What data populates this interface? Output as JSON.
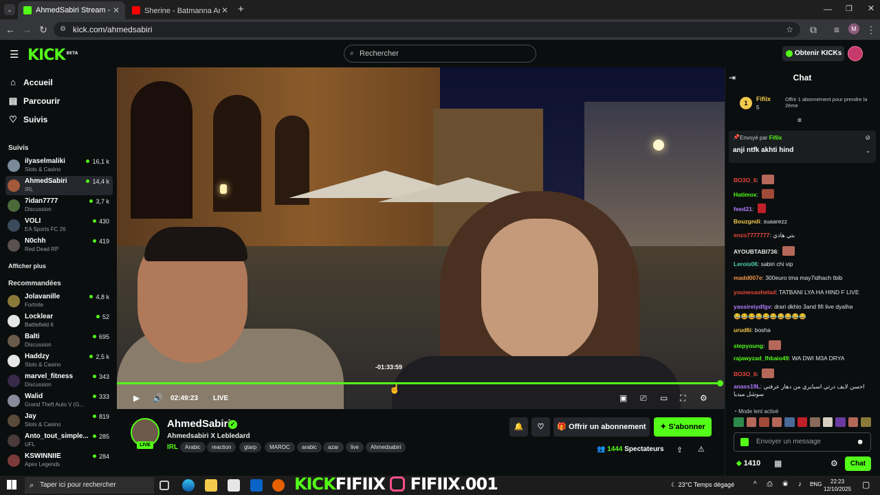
{
  "browser": {
    "tabs": [
      {
        "title": "AhmedSabiri Stream - Watch Live",
        "active": true
      },
      {
        "title": "Sherine - Batmanna Ansak | لان",
        "active": false
      }
    ],
    "url": "kick.com/ahmedsabiri",
    "profile_initial": "M"
  },
  "header": {
    "logo": "KICK",
    "logo_sup": "BETA",
    "search_placeholder": "Rechercher",
    "get_kicks": "Obtenir KICKs"
  },
  "sidebar": {
    "nav": [
      {
        "label": "Accueil",
        "icon": "home-icon"
      },
      {
        "label": "Parcourir",
        "icon": "browse-icon"
      },
      {
        "label": "Suivis",
        "icon": "heart-icon"
      }
    ],
    "followed_title": "Suivis",
    "followed": [
      {
        "name": "ilyaselmaliki",
        "category": "Slots & Casino",
        "viewers": "16,1 k",
        "color": "#7a8a99"
      },
      {
        "name": "AhmedSabiri",
        "category": "IRL",
        "viewers": "14,4 k",
        "color": "#a35a3a"
      },
      {
        "name": "7idan7777",
        "category": "Discussion",
        "viewers": "3,7 k",
        "color": "#4a6a3a"
      },
      {
        "name": "VOLI",
        "category": "EA Sports FC 26",
        "viewers": "430",
        "color": "#3a4a5a"
      },
      {
        "name": "N0chh",
        "category": "Red Dead RP",
        "viewers": "419",
        "color": "#5a5050"
      }
    ],
    "show_more": "Afficher plus",
    "recommended_title": "Recommandées",
    "recommended": [
      {
        "name": "Jolavanille",
        "category": "Fortnite",
        "viewers": "4,8 k",
        "color": "#8a7a3a"
      },
      {
        "name": "Locklear",
        "category": "Battlefield 6",
        "viewers": "52",
        "color": "#ffffff"
      },
      {
        "name": "Balti",
        "category": "Discussion",
        "viewers": "695",
        "color": "#6a5a4a"
      },
      {
        "name": "Haddzy",
        "category": "Slots & Casino",
        "viewers": "2,5 k",
        "color": "#e6e6e6"
      },
      {
        "name": "marvel_fitness",
        "category": "Discussion",
        "viewers": "343",
        "color": "#3a2a4a"
      },
      {
        "name": "Walid",
        "category": "Grand Theft Auto V (G...",
        "viewers": "333",
        "color": "#8a8a9a"
      },
      {
        "name": "Jay",
        "category": "Slots & Casino",
        "viewers": "819",
        "color": "#5a4a3a"
      },
      {
        "name": "Anto_tout_simple...",
        "category": "UFL",
        "viewers": "285",
        "color": "#4a3a3a"
      },
      {
        "name": "KSWINNIIE",
        "category": "Apex Legends",
        "viewers": "284",
        "color": "#7a3a3a"
      }
    ]
  },
  "player": {
    "hover_time": "-01:33:59",
    "elapsed": "02:49:23",
    "live_label": "LIVE",
    "progress": 1.0
  },
  "stream": {
    "name": "AhmedSabiri",
    "title": "Ahmedsabiri X Lebledard",
    "category": "IRL",
    "tags": [
      "Arabic",
      "reaction",
      "gtarp",
      "MAROC",
      "arabic",
      "azar",
      "live",
      "Ahmedsabiri"
    ],
    "live_badge": "LIVE",
    "subscribe_gift": "Offrir un abonnement",
    "subscribe": "S'abonner",
    "viewers_count": "1444",
    "viewers_label": "Spectateurs"
  },
  "chat": {
    "title": "Chat",
    "top_gifter": {
      "rank": "1",
      "name": "Fifiix",
      "count": "5",
      "offer": "Offrir 1 abonnement pour prendre la 2ème"
    },
    "pinned": {
      "sent_by": "Envoyé par",
      "author": "Fifiix",
      "text": "anji ntfk akhti hind"
    },
    "messages": [
      {
        "user": "BO3O_6",
        "text": "",
        "color": "#e8473c",
        "emote": true
      },
      {
        "user": "Hatimox",
        "text": "",
        "color": "#53fc18",
        "emote": true
      },
      {
        "user": "feed21",
        "text": "",
        "color": "#b47cff",
        "emote": true
      },
      {
        "user": "Bouzgndi",
        "text": "suaarezz",
        "color": "#f2c94c"
      },
      {
        "user": "enzo7777777",
        "text": "بتي هادي",
        "color": "#e8473c"
      },
      {
        "user": "AYOUBTABI736",
        "text": "",
        "color": "#e6e6e6",
        "emote": true
      },
      {
        "user": "Lerois06",
        "text": "sabiri chi vip",
        "color": "#4cd6a8"
      },
      {
        "user": "madd007e",
        "text": "300euro tma may7idhach tbib",
        "color": "#f2994a"
      },
      {
        "user": "younesashelad",
        "text": "TATBANI LYA HA HIND F LIVE",
        "color": "#e8473c"
      },
      {
        "user": "yassireiydfgv",
        "text": "drari dkhlo 3and fifi live dyalha",
        "color": "#b47cff"
      },
      {
        "user": "",
        "text": "😂😂😂😂😂😂😂😂😂😂",
        "color": "#e6e6e6"
      },
      {
        "user": "urud6i",
        "text": "bosha",
        "color": "#f2c94c"
      },
      {
        "user": "stepyoung",
        "text": "",
        "color": "#53fc18",
        "emote": true
      },
      {
        "user": "rajawyzad_fhbaio49",
        "text": "WA DWI M3A DRYA",
        "color": "#53fc18"
      },
      {
        "user": "BO3O_6",
        "text": "",
        "color": "#e8473c",
        "emote": true
      },
      {
        "user": "anass19L",
        "text": "احسن لايف درتي اسبايري من دهار عرفتي سوشل ميديا",
        "color": "#b47cff"
      }
    ],
    "slow_mode": "Mode lent activé",
    "input_placeholder": "Envoyer un message",
    "kicks_balance": "1410",
    "send_label": "Chat"
  },
  "taskbar": {
    "search": "Taper ici pour rechercher",
    "banner_left": "KICK",
    "banner_mid": "FIFIIX",
    "banner_right": "FIFIIX.001",
    "temp": "23°C",
    "weather": "Temps dégagé",
    "lang": "ENG",
    "time": "22:23",
    "date": "12/10/2025"
  },
  "colors": {
    "accent": "#53fc18",
    "bg": "#0b0e0f"
  }
}
